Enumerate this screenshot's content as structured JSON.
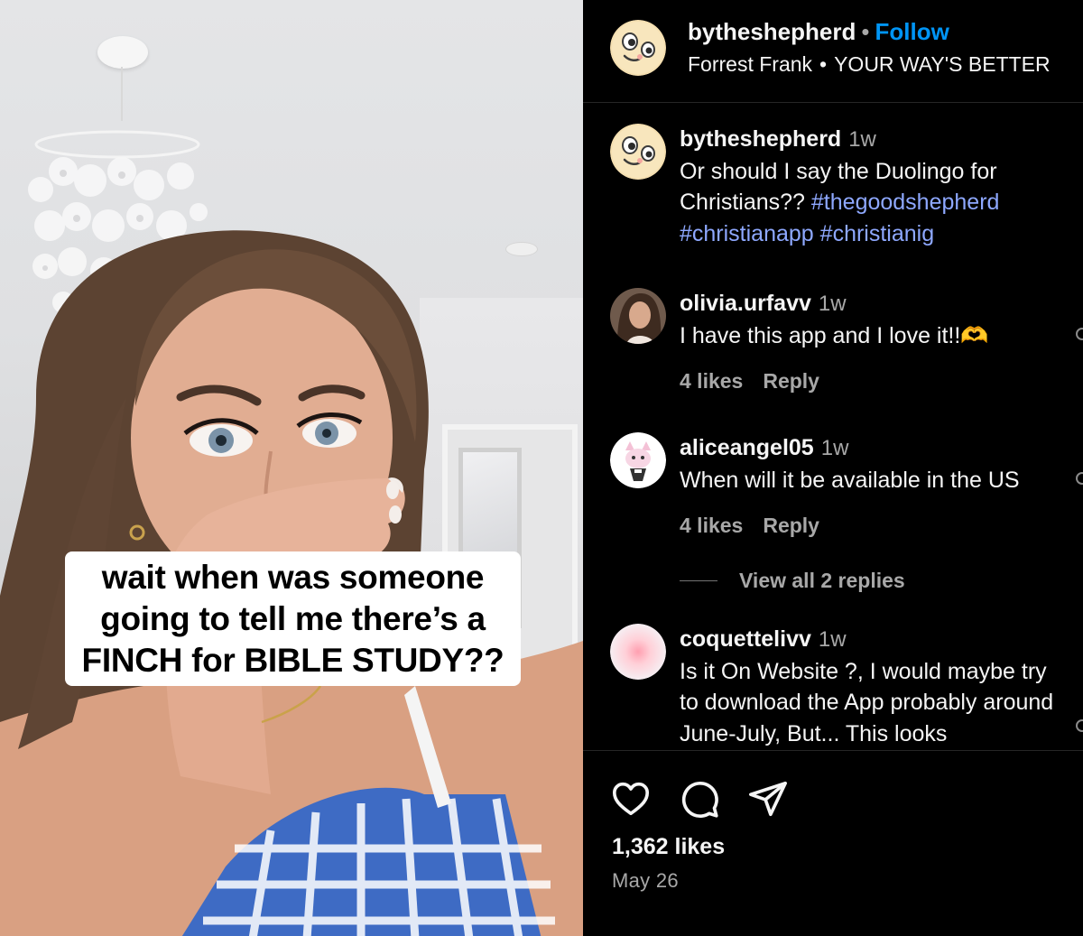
{
  "video": {
    "caption": "wait when was someone\ngoing to tell me there’s a\nFINCH for BIBLE STUDY??"
  },
  "header": {
    "username": "bytheshepherd",
    "separator": "•",
    "follow_label": "Follow",
    "audio_artist": "Forrest Frank",
    "audio_bullet": "•",
    "audio_track": "YOUR WAY'S BETTER",
    "avatar_icon": "cartoon-face-icon"
  },
  "comments": [
    {
      "username": "bytheshepherd",
      "time": "1w",
      "text_plain": "Or should I say the Duolingo for Christians??",
      "hashtags": [
        "#thegoodshepherd",
        "#christianapp",
        "#christianig"
      ],
      "avatar_icon": "cartoon-face-icon"
    },
    {
      "username": "olivia.urfavv",
      "time": "1w",
      "text": "I have this app and I love it!!🫶",
      "likes": "4 likes",
      "reply_label": "Reply",
      "avatar_icon": "profile-photo"
    },
    {
      "username": "aliceangel05",
      "time": "1w",
      "text": "When will it be available in the US",
      "likes": "4 likes",
      "reply_label": "Reply",
      "view_replies": "View all 2 replies",
      "avatar_icon": "kitty-avatar-icon"
    },
    {
      "username": "coquettelivv",
      "time": "1w",
      "text": "Is it On Website ?, I would maybe try to download the App probably around June-July, But... This looks",
      "avatar_icon": "pink-glow-avatar"
    }
  ],
  "footer": {
    "likes": "1,362 likes",
    "date": "May 26",
    "icons": [
      "heart-icon",
      "comment-icon",
      "share-icon"
    ]
  },
  "colors": {
    "background": "#000000",
    "link_blue": "#0095f6",
    "hashtag": "#8ea8ff",
    "muted": "#a8a8a8"
  }
}
